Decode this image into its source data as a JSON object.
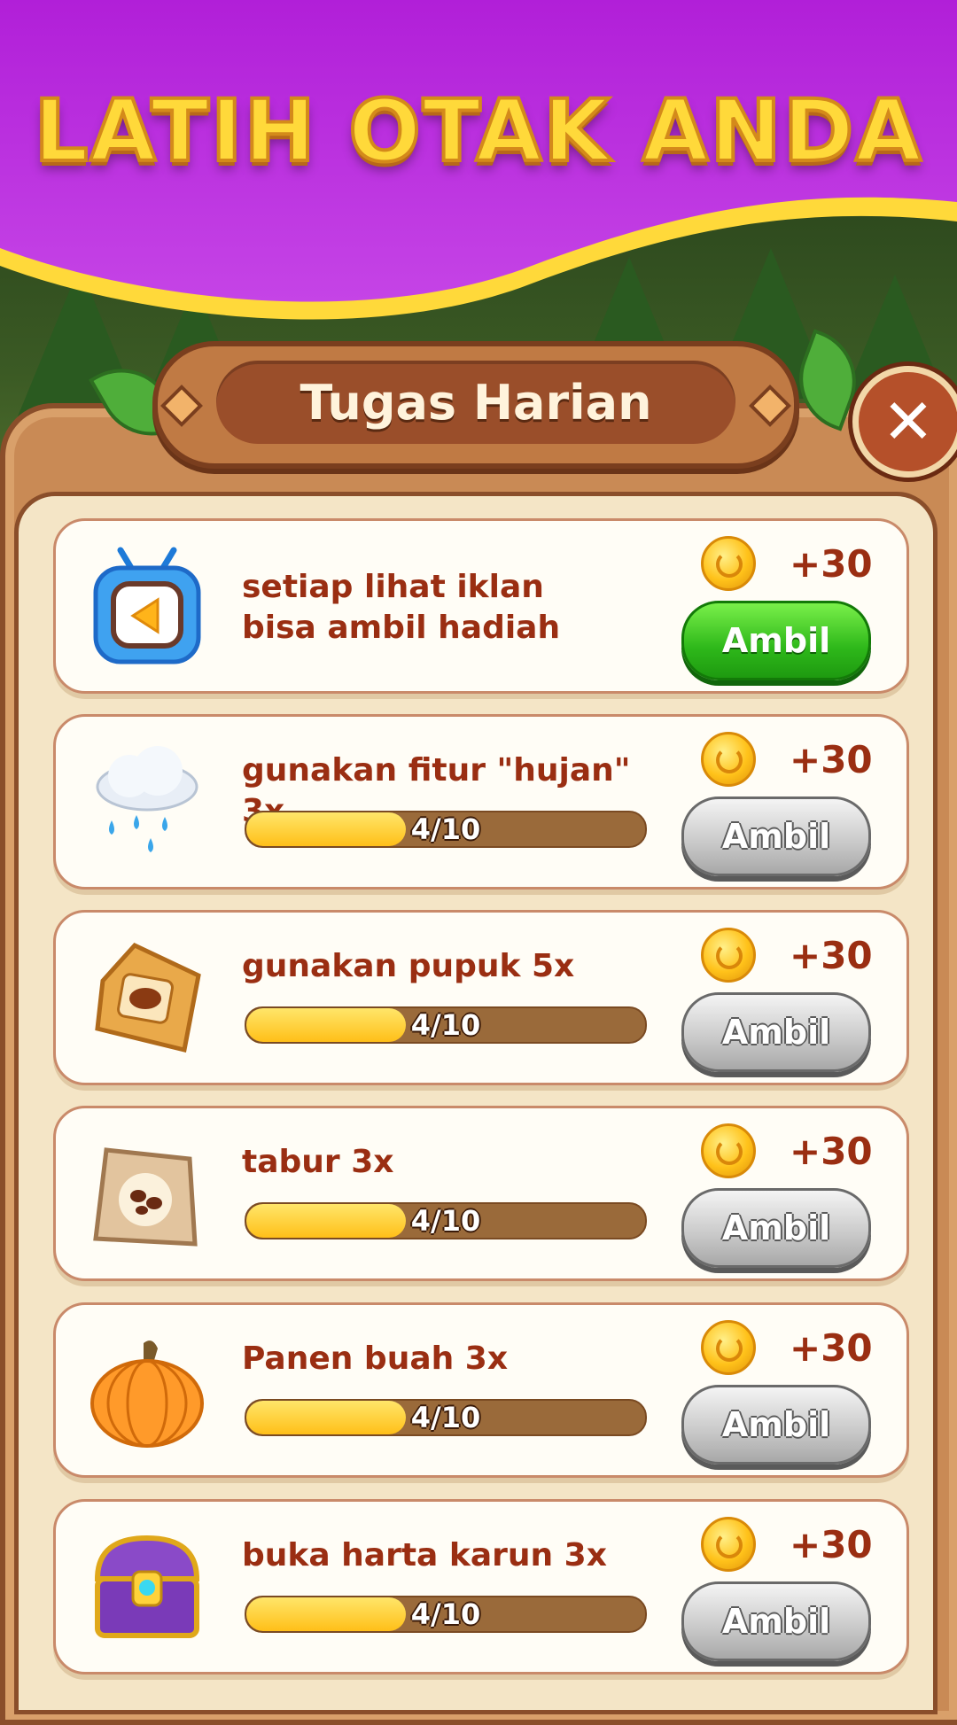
{
  "header": {
    "banner_title": "LATIH OTAK ANDA"
  },
  "dialog": {
    "title": "Tugas Harian",
    "close_glyph": "✕"
  },
  "tasks": [
    {
      "icon": "tv-play-icon",
      "description": "setiap lihat iklan bisa ambil hadiah",
      "has_progress": false,
      "reward": "+30",
      "button_label": "Ambil",
      "button_state": "active"
    },
    {
      "icon": "rain-cloud-icon",
      "description": "gunakan fitur \"hujan\" 3x",
      "has_progress": true,
      "progress_text": "4/10",
      "progress_fraction": 0.4,
      "reward": "+30",
      "button_label": "Ambil",
      "button_state": "disabled"
    },
    {
      "icon": "fertilizer-bag-icon",
      "description": "gunakan pupuk 5x",
      "has_progress": true,
      "progress_text": "4/10",
      "progress_fraction": 0.4,
      "reward": "+30",
      "button_label": "Ambil",
      "button_state": "disabled"
    },
    {
      "icon": "seed-packet-icon",
      "description": "tabur 3x",
      "has_progress": true,
      "progress_text": "4/10",
      "progress_fraction": 0.4,
      "reward": "+30",
      "button_label": "Ambil",
      "button_state": "disabled"
    },
    {
      "icon": "pumpkin-icon",
      "description": "Panen buah 3x",
      "has_progress": true,
      "progress_text": "4/10",
      "progress_fraction": 0.4,
      "reward": "+30",
      "button_label": "Ambil",
      "button_state": "disabled"
    },
    {
      "icon": "treasure-chest-icon",
      "description": "buka harta karun 3x",
      "has_progress": true,
      "progress_text": "4/10",
      "progress_fraction": 0.4,
      "reward": "+30",
      "button_label": "Ambil",
      "button_state": "disabled"
    }
  ],
  "colors": {
    "banner_purple": "#b722dc",
    "banner_yellow": "#ffd93a",
    "text_brown": "#9a2e12",
    "button_green": "#2eb81a",
    "button_gray": "#c8c8c8"
  }
}
